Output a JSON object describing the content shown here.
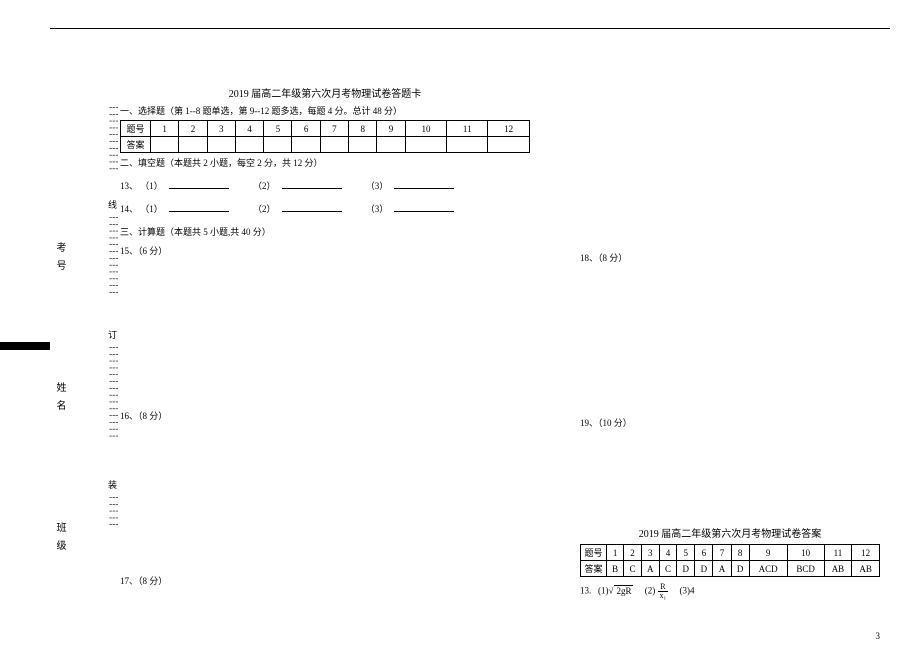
{
  "margin": {
    "labels": [
      "考号",
      "姓名",
      "班级"
    ],
    "dotted_chars": [
      "线",
      "订",
      "装"
    ]
  },
  "left": {
    "title": "2019 届高二年级第六次月考物理试卷答题卡",
    "section1": "一、选择题（第 1--8 题单选，第 9--12 题多选，每题 4 分。总计 48 分）",
    "table": {
      "row_label1": "题号",
      "row_label2": "答案",
      "cols": [
        "1",
        "2",
        "3",
        "4",
        "5",
        "6",
        "7",
        "8",
        "9",
        "10",
        "11",
        "12"
      ]
    },
    "section2": "二、填空题（本题共 2 小题，每空 2 分，共 12 分）",
    "q13": {
      "label": "13、",
      "p1": "（1）",
      "p2": "（2）",
      "p3": "（3）"
    },
    "q14": {
      "label": "14、",
      "p1": "（1）",
      "p2": "（2）",
      "p3": "（3）"
    },
    "section3": "三、计算题（本题共 5 小题,共 40 分）",
    "q15": "15、（6 分）",
    "q16": "16、（8 分）",
    "q17": "17、（8 分）"
  },
  "right": {
    "q18": "18、（8 分）",
    "q19": "19、（10 分）",
    "ans_title": "2019 届高二年级第六次月考物理试卷答案",
    "ans_table": {
      "row_label1": "题号",
      "row_label2": "答案",
      "cols": [
        "1",
        "2",
        "3",
        "4",
        "5",
        "6",
        "7",
        "8",
        "9",
        "10",
        "11",
        "12"
      ],
      "answers": [
        "B",
        "C",
        "A",
        "C",
        "D",
        "D",
        "A",
        "D",
        "ACD",
        "BCD",
        "AB",
        "AB"
      ]
    },
    "q13ans": {
      "label": "13.",
      "p1_prefix": "(1)",
      "p1_sqrt_inner": "2gR",
      "p2_prefix": "(2)",
      "p2_frac_num": "R",
      "p2_frac_den": "x₁",
      "p3": "(3)4"
    }
  },
  "page_number": "3"
}
